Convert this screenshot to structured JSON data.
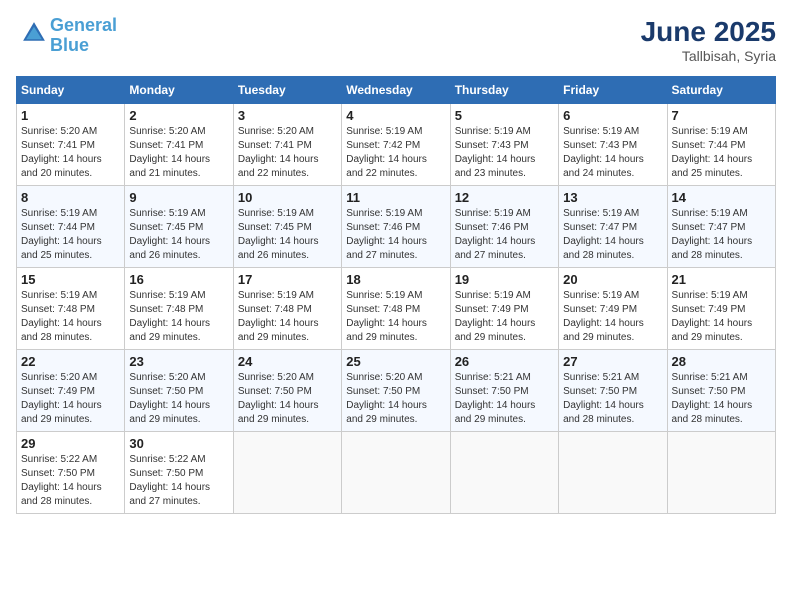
{
  "header": {
    "logo_line1": "General",
    "logo_line2": "Blue",
    "title": "June 2025",
    "subtitle": "Tallbisah, Syria"
  },
  "days_of_week": [
    "Sunday",
    "Monday",
    "Tuesday",
    "Wednesday",
    "Thursday",
    "Friday",
    "Saturday"
  ],
  "weeks": [
    [
      {
        "day": "1",
        "sunrise": "5:20 AM",
        "sunset": "7:41 PM",
        "daylight": "14 hours and 20 minutes."
      },
      {
        "day": "2",
        "sunrise": "5:20 AM",
        "sunset": "7:41 PM",
        "daylight": "14 hours and 21 minutes."
      },
      {
        "day": "3",
        "sunrise": "5:20 AM",
        "sunset": "7:41 PM",
        "daylight": "14 hours and 22 minutes."
      },
      {
        "day": "4",
        "sunrise": "5:19 AM",
        "sunset": "7:42 PM",
        "daylight": "14 hours and 22 minutes."
      },
      {
        "day": "5",
        "sunrise": "5:19 AM",
        "sunset": "7:43 PM",
        "daylight": "14 hours and 23 minutes."
      },
      {
        "day": "6",
        "sunrise": "5:19 AM",
        "sunset": "7:43 PM",
        "daylight": "14 hours and 24 minutes."
      },
      {
        "day": "7",
        "sunrise": "5:19 AM",
        "sunset": "7:44 PM",
        "daylight": "14 hours and 25 minutes."
      }
    ],
    [
      {
        "day": "8",
        "sunrise": "5:19 AM",
        "sunset": "7:44 PM",
        "daylight": "14 hours and 25 minutes."
      },
      {
        "day": "9",
        "sunrise": "5:19 AM",
        "sunset": "7:45 PM",
        "daylight": "14 hours and 26 minutes."
      },
      {
        "day": "10",
        "sunrise": "5:19 AM",
        "sunset": "7:45 PM",
        "daylight": "14 hours and 26 minutes."
      },
      {
        "day": "11",
        "sunrise": "5:19 AM",
        "sunset": "7:46 PM",
        "daylight": "14 hours and 27 minutes."
      },
      {
        "day": "12",
        "sunrise": "5:19 AM",
        "sunset": "7:46 PM",
        "daylight": "14 hours and 27 minutes."
      },
      {
        "day": "13",
        "sunrise": "5:19 AM",
        "sunset": "7:47 PM",
        "daylight": "14 hours and 28 minutes."
      },
      {
        "day": "14",
        "sunrise": "5:19 AM",
        "sunset": "7:47 PM",
        "daylight": "14 hours and 28 minutes."
      }
    ],
    [
      {
        "day": "15",
        "sunrise": "5:19 AM",
        "sunset": "7:48 PM",
        "daylight": "14 hours and 28 minutes."
      },
      {
        "day": "16",
        "sunrise": "5:19 AM",
        "sunset": "7:48 PM",
        "daylight": "14 hours and 29 minutes."
      },
      {
        "day": "17",
        "sunrise": "5:19 AM",
        "sunset": "7:48 PM",
        "daylight": "14 hours and 29 minutes."
      },
      {
        "day": "18",
        "sunrise": "5:19 AM",
        "sunset": "7:48 PM",
        "daylight": "14 hours and 29 minutes."
      },
      {
        "day": "19",
        "sunrise": "5:19 AM",
        "sunset": "7:49 PM",
        "daylight": "14 hours and 29 minutes."
      },
      {
        "day": "20",
        "sunrise": "5:19 AM",
        "sunset": "7:49 PM",
        "daylight": "14 hours and 29 minutes."
      },
      {
        "day": "21",
        "sunrise": "5:19 AM",
        "sunset": "7:49 PM",
        "daylight": "14 hours and 29 minutes."
      }
    ],
    [
      {
        "day": "22",
        "sunrise": "5:20 AM",
        "sunset": "7:49 PM",
        "daylight": "14 hours and 29 minutes."
      },
      {
        "day": "23",
        "sunrise": "5:20 AM",
        "sunset": "7:50 PM",
        "daylight": "14 hours and 29 minutes."
      },
      {
        "day": "24",
        "sunrise": "5:20 AM",
        "sunset": "7:50 PM",
        "daylight": "14 hours and 29 minutes."
      },
      {
        "day": "25",
        "sunrise": "5:20 AM",
        "sunset": "7:50 PM",
        "daylight": "14 hours and 29 minutes."
      },
      {
        "day": "26",
        "sunrise": "5:21 AM",
        "sunset": "7:50 PM",
        "daylight": "14 hours and 29 minutes."
      },
      {
        "day": "27",
        "sunrise": "5:21 AM",
        "sunset": "7:50 PM",
        "daylight": "14 hours and 28 minutes."
      },
      {
        "day": "28",
        "sunrise": "5:21 AM",
        "sunset": "7:50 PM",
        "daylight": "14 hours and 28 minutes."
      }
    ],
    [
      {
        "day": "29",
        "sunrise": "5:22 AM",
        "sunset": "7:50 PM",
        "daylight": "14 hours and 28 minutes."
      },
      {
        "day": "30",
        "sunrise": "5:22 AM",
        "sunset": "7:50 PM",
        "daylight": "14 hours and 27 minutes."
      },
      null,
      null,
      null,
      null,
      null
    ]
  ],
  "labels": {
    "sunrise": "Sunrise:",
    "sunset": "Sunset:",
    "daylight": "Daylight:"
  }
}
